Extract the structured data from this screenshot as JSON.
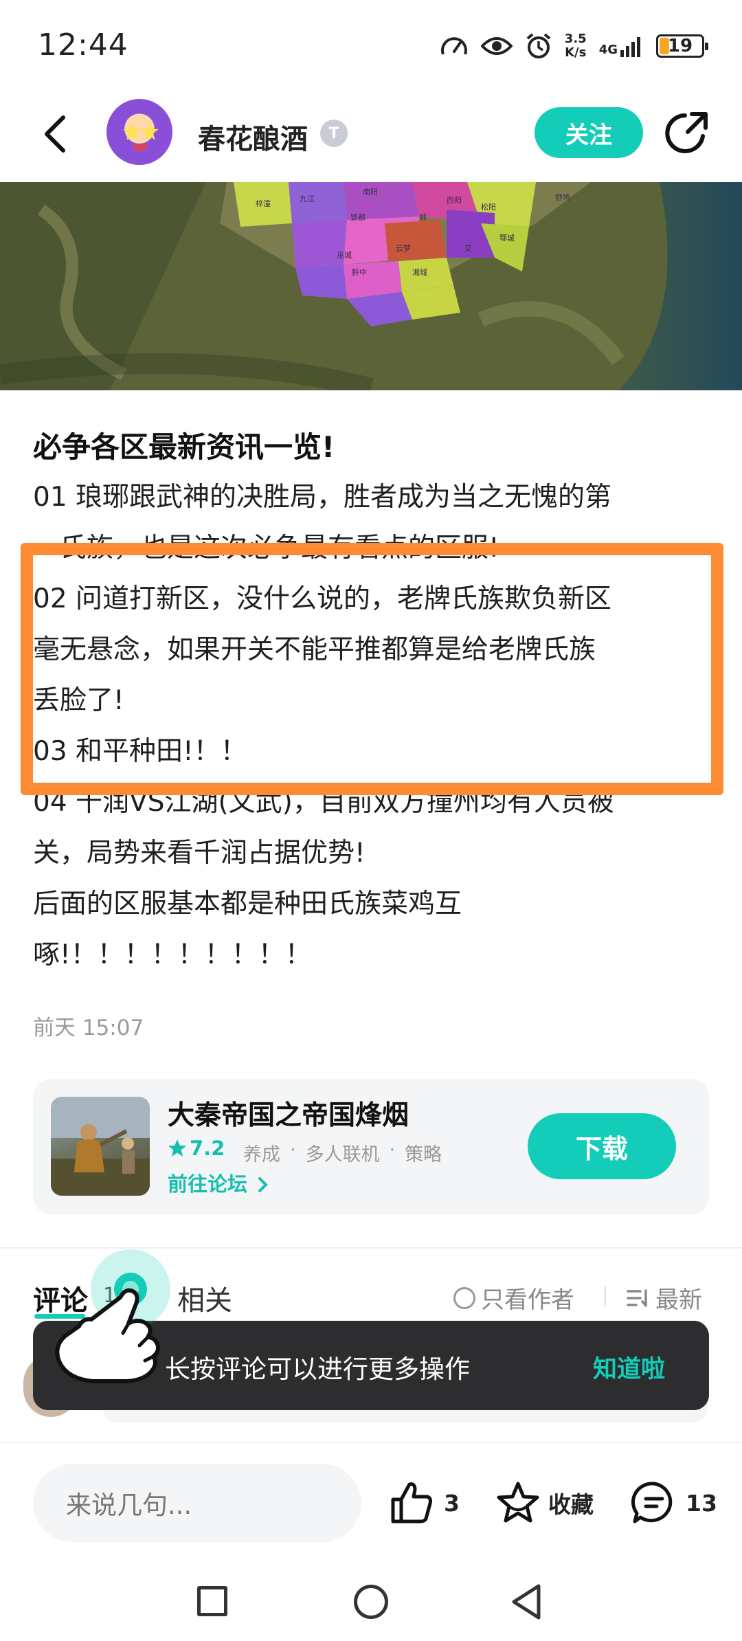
{
  "status_bar": {
    "time": "12:44",
    "net_speed_value": "3.5",
    "net_speed_unit": "K/s",
    "net_type": "4G",
    "battery": "19"
  },
  "header": {
    "username": "春花酿酒",
    "level_badge": "T",
    "follow_label": "关注"
  },
  "map": {
    "labels": [
      "梓潼",
      "九江",
      "南阳",
      "西阳",
      "舒鸠",
      "松阳",
      "郢都",
      "郧",
      "鄂城",
      "巫城",
      "云梦",
      "艾",
      "黔中",
      "湘城"
    ]
  },
  "article": {
    "title": "必争各区最新资讯一览!",
    "lines": [
      "01  琅琊跟武神的决胜局，胜者成为当之无愧的第",
      "一氏族，也是这次必争最有看点的区服!",
      "02  问道打新区，没什么说的，老牌氏族欺负新区",
      "毫无悬念，如果开关不能平推都算是给老牌氏族",
      "丢脸了!",
      "03   和平种田!！！",
      "04   千润VS江湖(文武)，目前双方撞州均有人员被",
      "关，局势来看千润占据优势!",
      "后面的区服基本都是种田氏族菜鸡互",
      "啄!！！！！！！！！！"
    ],
    "time": "前天 15:07"
  },
  "game_card": {
    "name": "大秦帝国之帝国烽烟",
    "rating": "7.2",
    "tags": [
      "养成",
      "·",
      "多人联机",
      "·",
      "策略"
    ],
    "forum_link": "前往论坛",
    "download_label": "下载"
  },
  "tabs": {
    "comments": "评论",
    "comments_count": "13",
    "related": "相关",
    "author_only": "只看作者",
    "sort": "最新"
  },
  "tooltip": {
    "text": "长按评论可以进行更多操作",
    "ok": "知道啦"
  },
  "bottom_bar": {
    "input_placeholder": "来说几句...",
    "likes": "3",
    "favorite": "收藏",
    "comments": "13"
  },
  "colors": {
    "accent": "#14cdb8",
    "highlight_box": "#ff8a34",
    "tooltip_bg": "#2d2d2f"
  }
}
